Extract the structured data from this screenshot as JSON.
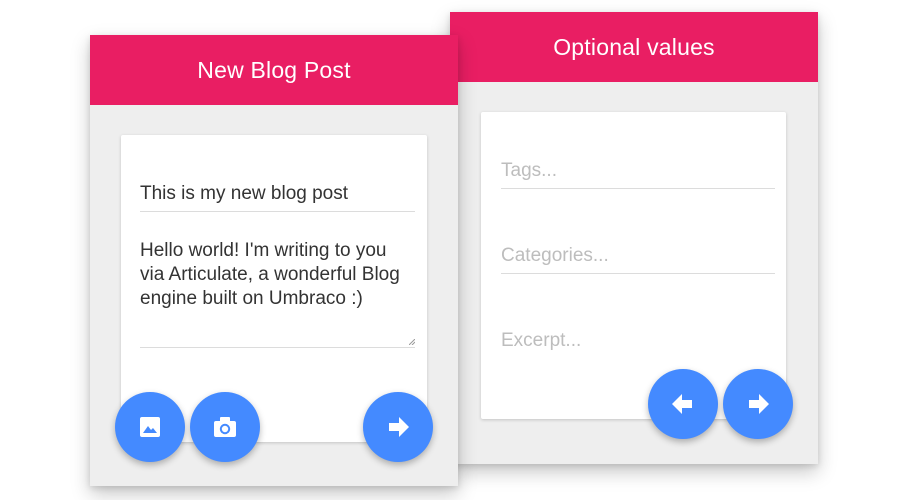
{
  "new_post": {
    "title": "New Blog Post",
    "post_title_value": "This is my new blog post",
    "post_body_value": "Hello world! I'm writing to you via Articulate, a wonderful Blog engine built on Umbraco :)"
  },
  "optional": {
    "title": "Optional values",
    "tags_placeholder": "Tags...",
    "categories_placeholder": "Categories...",
    "excerpt_placeholder": "Excerpt..."
  },
  "icons": {
    "image": "image-icon",
    "camera": "camera-icon",
    "next": "arrow-right-icon",
    "back": "arrow-left-icon"
  },
  "colors": {
    "header": "#e91e63",
    "fab": "#448aff",
    "panel_bg": "#eeeeee"
  }
}
